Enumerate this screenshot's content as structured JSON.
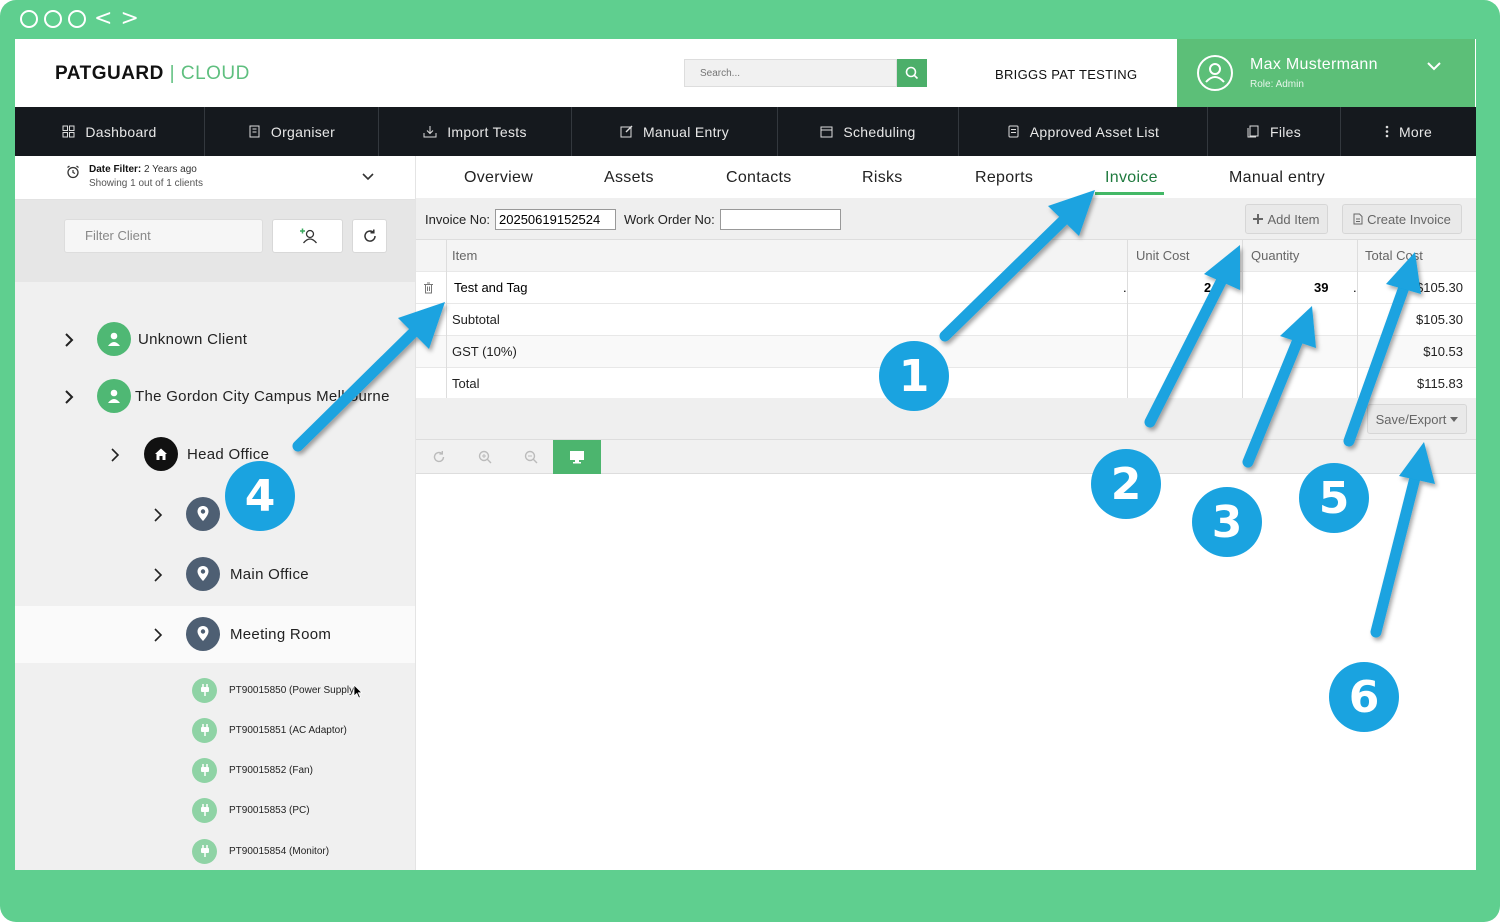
{
  "brand": {
    "pat": "PAT",
    "guard": "GUARD",
    "sep": " | ",
    "cloud": "CLOUD"
  },
  "search": {
    "placeholder": "Search..."
  },
  "company": "BRIGGS PAT TESTING",
  "user": {
    "name": "Max Mustermann",
    "role": "Role: Admin"
  },
  "nav": [
    {
      "label": "Dashboard",
      "icon": "grid-icon"
    },
    {
      "label": "Organiser",
      "icon": "building-icon"
    },
    {
      "label": "Import Tests",
      "icon": "download-icon"
    },
    {
      "label": "Manual Entry",
      "icon": "edit-icon"
    },
    {
      "label": "Scheduling",
      "icon": "calendar-icon"
    },
    {
      "label": "Approved Asset List",
      "icon": "list-icon"
    },
    {
      "label": "Files",
      "icon": "files-icon"
    },
    {
      "label": "More",
      "icon": "more-icon"
    }
  ],
  "date_filter": {
    "label": "Date Filter:",
    "value": " 2 Years ago",
    "showing": "Showing 1 out of 1 clients"
  },
  "filter_client": {
    "placeholder": "Filter Client"
  },
  "tree": {
    "unknown_client": "Unknown Client",
    "campus": "The Gordon City Campus Melbourne",
    "head_office": "Head Office",
    "hidden_location": "",
    "main_office": "Main Office",
    "meeting_room": "Meeting Room"
  },
  "assets": [
    "PT90015850 (Power Supply)",
    "PT90015851 (AC Adaptor)",
    "PT90015852 (Fan)",
    "PT90015853 (PC)",
    "PT90015854 (Monitor)"
  ],
  "tabs": [
    "Overview",
    "Assets",
    "Contacts",
    "Risks",
    "Reports",
    "Invoice",
    "Manual entry"
  ],
  "invoice": {
    "invoice_no_label": "Invoice No:",
    "invoice_no": "20250619152524",
    "work_order_label": "Work Order No:",
    "work_order": "",
    "add_item": "Add Item",
    "create_invoice": "Create Invoice",
    "columns": {
      "item": "Item",
      "unit_cost": "Unit Cost",
      "quantity": "Quantity",
      "total_cost": "Total Cost"
    },
    "line": {
      "item": "Test and Tag",
      "unit_cost": "2.",
      "quantity": "39",
      "total": "$105.30"
    },
    "subtotal_label": "Subtotal",
    "subtotal": "$105.30",
    "gst_label": "GST (10%)",
    "gst": "$10.53",
    "total_label": "Total",
    "total": "$115.83",
    "save_export": "Save/Export"
  },
  "callouts": [
    "1",
    "2",
    "3",
    "4",
    "5",
    "6"
  ],
  "colors": {
    "accent_green": "#5cbf78",
    "callout_blue": "#1aa3e0",
    "nav_dark": "#15191e"
  }
}
